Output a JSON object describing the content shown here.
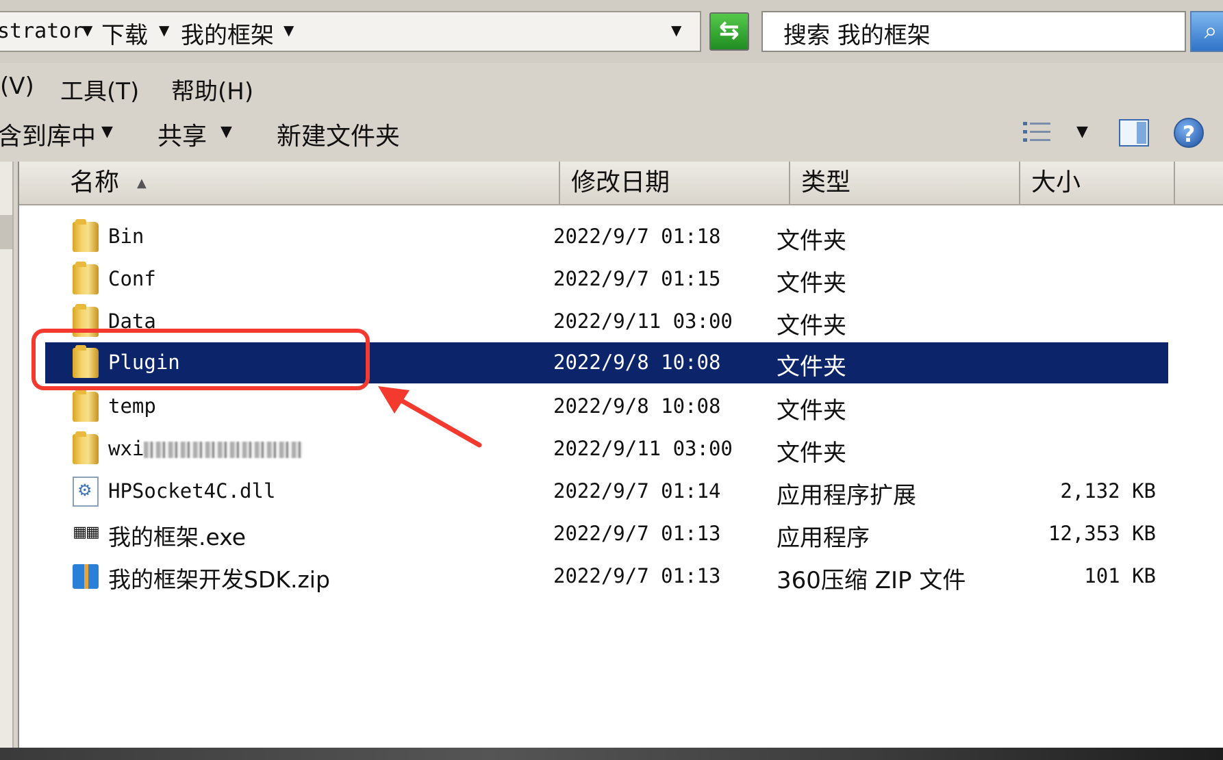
{
  "address_bar": {
    "crumbs": [
      "strator",
      "下载",
      "我的框架"
    ]
  },
  "search": {
    "placeholder": "搜索 我的框架"
  },
  "menu": {
    "items": [
      "(V)",
      "工具(T)",
      "帮助(H)"
    ]
  },
  "toolbar": {
    "include_library": "含到库中",
    "share": "共享",
    "new_folder": "新建文件夹"
  },
  "columns": {
    "name": "名称",
    "date": "修改日期",
    "type": "类型",
    "size": "大小"
  },
  "files": [
    {
      "name": "Bin",
      "date": "2022/9/7 01:18",
      "type": "文件夹",
      "size": "",
      "icon": "folder-icon"
    },
    {
      "name": "Conf",
      "date": "2022/9/7 01:15",
      "type": "文件夹",
      "size": "",
      "icon": "folder-icon"
    },
    {
      "name": "Data",
      "date": "2022/9/11 03:00",
      "type": "文件夹",
      "size": "",
      "icon": "folder-icon"
    },
    {
      "name": "Plugin",
      "date": "2022/9/8 10:08",
      "type": "文件夹",
      "size": "",
      "icon": "folder-icon",
      "selected": true
    },
    {
      "name": "temp",
      "date": "2022/9/8 10:08",
      "type": "文件夹",
      "size": "",
      "icon": "folder-icon"
    },
    {
      "name": "wxi",
      "date": "2022/9/11 03:00",
      "type": "文件夹",
      "size": "",
      "icon": "folder-icon"
    },
    {
      "name": "HPSocket4C.dll",
      "date": "2022/9/7 01:14",
      "type": "应用程序扩展",
      "size": "2,132 KB",
      "icon": "dll-icon"
    },
    {
      "name": "我的框架.exe",
      "date": "2022/9/7 01:13",
      "type": "应用程序",
      "size": "12,353 KB",
      "icon": "exe-icon"
    },
    {
      "name": "我的框架开发SDK.zip",
      "date": "2022/9/7 01:13",
      "type": "360压缩 ZIP 文件",
      "size": "101 KB",
      "icon": "zip-icon"
    }
  ],
  "colors": {
    "selection": "#0c246a",
    "annotation": "#f43a2e"
  }
}
